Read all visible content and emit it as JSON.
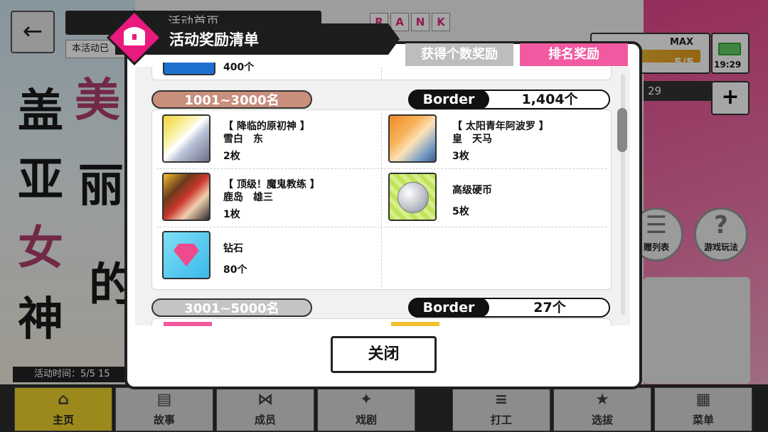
{
  "background": {
    "header_title": "活动首页",
    "header_sub": "本活动已",
    "title_chars": [
      "美",
      "盖",
      "亚",
      "女",
      "神",
      "丽",
      "的"
    ],
    "rank_letters": [
      "R",
      "A",
      "N",
      "K"
    ],
    "stat_max": "MAX",
    "stat_value": "5/5",
    "clock": "19:29",
    "stat2": "29",
    "circle_buttons": [
      {
        "label": "赠列表",
        "icon": "gift-icon"
      },
      {
        "label": "游戏玩法",
        "icon": "question-icon"
      }
    ],
    "period": "活动时间：5/5 15"
  },
  "nav": [
    {
      "label": "主页",
      "icon": "home-icon",
      "active": true
    },
    {
      "label": "故事",
      "icon": "book-icon"
    },
    {
      "label": "成员",
      "icon": "bowtie-icon"
    },
    {
      "label": "戏剧",
      "icon": "stage-icon"
    },
    {
      "label": "打工",
      "icon": "coins-icon"
    },
    {
      "label": "选拔",
      "icon": "star-icon"
    },
    {
      "label": "菜单",
      "icon": "grid-icon"
    }
  ],
  "modal": {
    "title": "活动奖励清单",
    "tabs": [
      {
        "label": "获得个数奖励",
        "active": false
      },
      {
        "label": "排名奖励",
        "active": true
      }
    ],
    "partial_top_value": "400个",
    "sections": [
      {
        "rank_range": "1001~3000名",
        "border_label": "Border",
        "border_value": "1,404个",
        "rewards": [
          {
            "title": "【 降临的原初神 】",
            "name": "雪白　东",
            "qty": "2枚",
            "thumb": "card-silver-hair"
          },
          {
            "title": "【 太阳青年阿波罗 】",
            "name": "皇　天马",
            "qty": "3枚",
            "thumb": "card-orange-hair"
          },
          {
            "title": "【 顶级！魔鬼教练 】",
            "name": "鹿岛　雄三",
            "qty": "1枚",
            "thumb": "card-headband"
          },
          {
            "title": "",
            "name": "高级硬币",
            "qty": "5枚",
            "thumb": "coin-icon"
          },
          {
            "title": "",
            "name": "钻石",
            "qty": "80个",
            "thumb": "diamond-icon"
          }
        ]
      },
      {
        "rank_range": "3001~5000名",
        "border_label": "Border",
        "border_value": "27个"
      }
    ],
    "close_label": "关闭"
  }
}
